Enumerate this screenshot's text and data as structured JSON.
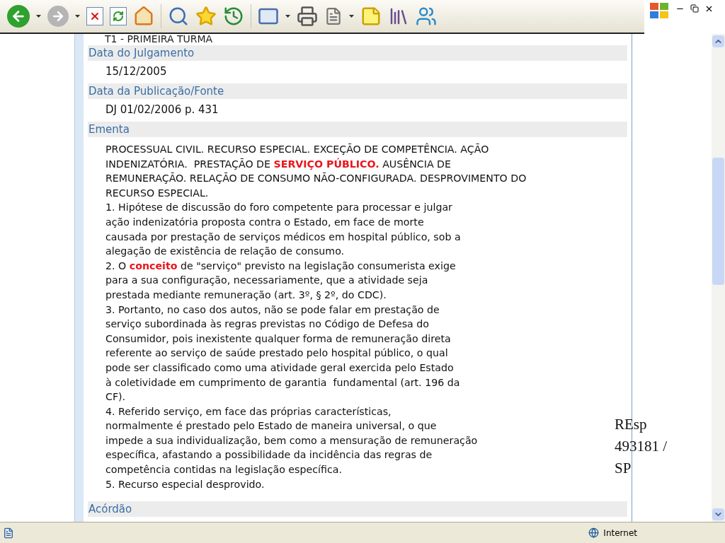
{
  "top_line": "T1 - PRIMEIRA TURMA",
  "sections": [
    {
      "heading": "Data do Julgamento",
      "lines": [
        "15/12/2005"
      ]
    },
    {
      "heading": "Data da Publicação/Fonte",
      "lines": [
        "DJ 01/02/2006 p. 431"
      ]
    },
    {
      "heading": "Ementa",
      "paragraphs": [
        [
          "PROCESSUAL CIVIL. RECURSO ESPECIAL. EXCEÇÃO DE COMPETÊNCIA. AÇÃO",
          "INDENIZATÓRIA.  PRESTAÇÃO DE **SERVIÇO PÚBLICO.** AUSÊNCIA DE",
          "REMUNERAÇÃO. RELAÇÃO DE CONSUMO NÃO-CONFIGURADA. DESPROVIMENTO DO",
          "RECURSO ESPECIAL."
        ],
        [
          "1. Hipótese de discussão do foro competente para processar e julgar",
          "ação indenizatória proposta contra o Estado, em face de morte",
          "causada por prestação de serviços médicos em hospital público, sob a",
          "alegação de existência de relação de consumo."
        ],
        [
          "2. O **conceito** de \"serviço\" previsto na legislação consumerista exige",
          "para a sua configuração, necessariamente, que a atividade seja",
          "prestada mediante remuneração (art. 3º, § 2º, do CDC)."
        ],
        [
          "3. Portanto, no caso dos autos, não se pode falar em prestação de",
          "serviço subordinada às regras previstas no Código de Defesa do",
          "Consumidor, pois inexistente qualquer forma de remuneração direta",
          "referente ao serviço de saúde prestado pelo hospital público, o qual",
          "pode ser classificado como uma atividade geral exercida pelo Estado",
          "à coletividade em cumprimento de garantia  fundamental (art. 196 da",
          "CF)."
        ],
        [
          "4. Referido serviço, em face das próprias características,",
          "normalmente é prestado pelo Estado de maneira universal, o que",
          "impede a sua individualização, bem como a mensuração de remuneração",
          "específica, afastando a possibilidade da incidência das regras de",
          "competência contidas na legislação específica."
        ],
        [
          "5. Recurso especial desprovido."
        ]
      ]
    },
    {
      "heading": "Acórdão"
    }
  ],
  "annotation": [
    "REsp",
    "493181 /",
    "SP"
  ],
  "status_bar": {
    "zone": "Internet"
  }
}
